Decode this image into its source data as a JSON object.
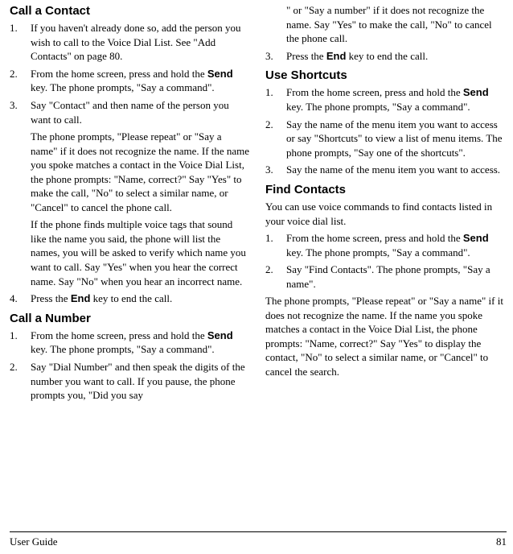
{
  "sections": {
    "call_contact": {
      "heading": "Call a Contact",
      "steps": [
        [
          "If you haven't already done so, add the person you wish to call to the Voice Dial List. See \"Add Contacts\" on page 80."
        ],
        [
          "From the home screen, press and hold the <b>Send</b> key. The phone prompts, \"Say a command\"."
        ],
        [
          "Say \"Contact\" and then name of the person you want to call.",
          "The phone prompts, \"Please repeat\" or \"Say a name\" if it does not recognize the name. If the name you spoke matches a contact in the Voice Dial List, the phone prompts: \"Name, correct?\" Say \"Yes\" to make the call, \"No\" to select a similar name, or \"Cancel\" to cancel the phone call.",
          "If the phone finds multiple voice tags that sound like the name you said, the phone will list the names, you will be asked to verify which name you want to call. Say \"Yes\" when you hear the correct name. Say \"No\" when you hear an incorrect name."
        ],
        [
          "Press the <b>End</b> key to end the call."
        ]
      ]
    },
    "call_number": {
      "heading": "Call a Number",
      "steps": [
        [
          "From the home screen, press and hold the <b>Send</b> key. The phone prompts, \"Say a command\"."
        ],
        [
          "Say \"Dial Number\" and then speak the digits of the number you want to call. If you pause, the phone prompts you, \"Did you say"
        ]
      ]
    },
    "call_number_cont": {
      "cont_text": "<number>\" or \"Say a number\" if it does not recognize the name. Say \"Yes\" to make the call, \"No\" to cancel the phone call.",
      "steps": [
        [
          "Press the <b>End</b> key to end the call."
        ]
      ],
      "start": 3
    },
    "use_shortcuts": {
      "heading": "Use Shortcuts",
      "steps": [
        [
          "From the home screen, press and hold the <b>Send</b> key. The phone prompts, \"Say a command\"."
        ],
        [
          "Say the name of the menu item you want to access or say \"Shortcuts\" to view a list of menu items. The phone prompts, \"Say one of the shortcuts\"."
        ],
        [
          "Say the name of the menu item you want to access."
        ]
      ]
    },
    "find_contacts": {
      "heading": "Find Contacts",
      "intro": "You can use voice commands to find contacts listed in your voice dial list.",
      "steps": [
        [
          "From the home screen, press and hold the <b>Send</b> key. The phone prompts, \"Say a command\"."
        ],
        [
          "Say \"Find Contacts\". The phone prompts, \"Say a name\"."
        ]
      ],
      "outro": "The phone prompts, \"Please repeat\" or \"Say a name\" if it does not recognize the name. If the name you spoke matches a contact in the Voice Dial List, the phone prompts: \"Name, correct?\" Say \"Yes\" to display the contact, \"No\" to select a similar name, or \"Cancel\" to cancel the search."
    }
  },
  "footer": {
    "left": "User Guide",
    "right": "81"
  }
}
